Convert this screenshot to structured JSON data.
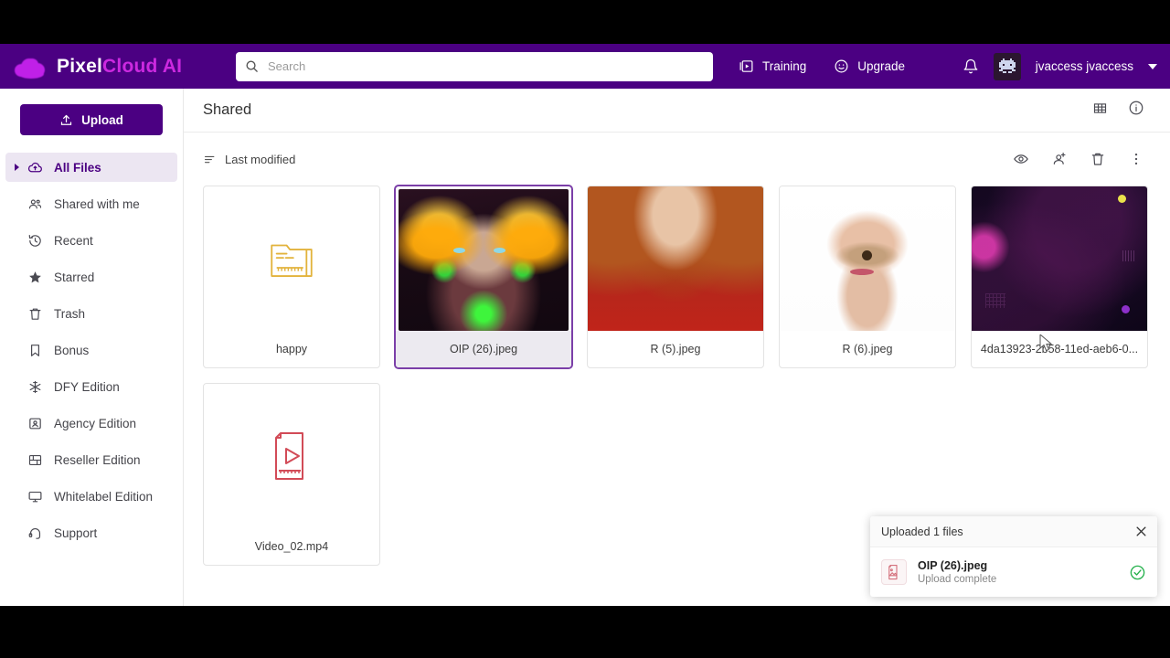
{
  "brand": {
    "name_white": "Pixel",
    "name_accent": "Cloud AI",
    "icon": "pixel-cloud-logo"
  },
  "colors": {
    "purple": "#4b0082",
    "accent_magenta": "#cc29e0",
    "selected_border": "#7b3fa8",
    "success_green": "#25b14c",
    "video_red": "#d24b57",
    "folder_yellow": "#e2b33c"
  },
  "search": {
    "placeholder": "Search",
    "value": "",
    "icon": "search-icon"
  },
  "topnav": [
    {
      "label": "Training",
      "icon": "video-library-icon"
    },
    {
      "label": "Upgrade",
      "icon": "upgrade-circle-icon"
    }
  ],
  "topright": {
    "notifications_icon": "bell-icon",
    "avatar_icon": "space-invader-avatar",
    "username": "jvaccess jvaccess",
    "caret_icon": "chevron-down-icon"
  },
  "sidebar": {
    "upload_label": "Upload",
    "upload_icon": "upload-icon",
    "items": [
      {
        "label": "All Files",
        "icon": "cloud-upload-icon",
        "active": true,
        "expand_icon": "triangle-right-icon"
      },
      {
        "label": "Shared with me",
        "icon": "people-icon",
        "active": false
      },
      {
        "label": "Recent",
        "icon": "clock-rewind-icon",
        "active": false
      },
      {
        "label": "Starred",
        "icon": "star-icon",
        "active": false
      },
      {
        "label": "Trash",
        "icon": "trash-icon",
        "active": false
      },
      {
        "label": "Bonus",
        "icon": "bookmark-icon",
        "active": false
      },
      {
        "label": "DFY Edition",
        "icon": "asterisk-icon",
        "active": false
      },
      {
        "label": "Agency Edition",
        "icon": "contact-card-icon",
        "active": false
      },
      {
        "label": "Reseller Edition",
        "icon": "layout-grid-icon",
        "active": false
      },
      {
        "label": "Whitelabel Edition",
        "icon": "monitor-icon",
        "active": false
      },
      {
        "label": "Support",
        "icon": "headset-icon",
        "active": false
      }
    ]
  },
  "main": {
    "title": "Shared",
    "head_icons": [
      {
        "name": "grid-view-icon"
      },
      {
        "name": "info-icon"
      }
    ],
    "sort": {
      "label": "Last modified",
      "icon": "sort-icon"
    },
    "tool_icons": [
      {
        "name": "preview-eye-icon"
      },
      {
        "name": "add-person-icon"
      },
      {
        "name": "delete-trash-icon"
      },
      {
        "name": "more-vertical-icon"
      }
    ],
    "files": [
      {
        "name": "happy",
        "type": "folder",
        "selected": false
      },
      {
        "name": "OIP (26).jpeg",
        "type": "image-cyber",
        "selected": true
      },
      {
        "name": "R (5).jpeg",
        "type": "image-woman",
        "selected": false
      },
      {
        "name": "R (6).jpeg",
        "type": "image-hand",
        "selected": false
      },
      {
        "name": "4da13923-2b58-11ed-aeb6-0...",
        "type": "image-dark",
        "selected": false
      },
      {
        "name": "Video_02.mp4",
        "type": "video",
        "selected": false
      }
    ]
  },
  "toast": {
    "title": "Uploaded 1 files",
    "close_icon": "close-icon",
    "file_name": "OIP (26).jpeg",
    "status": "Upload complete",
    "file_icon": "image-file-icon",
    "status_icon": "check-circle-icon"
  }
}
